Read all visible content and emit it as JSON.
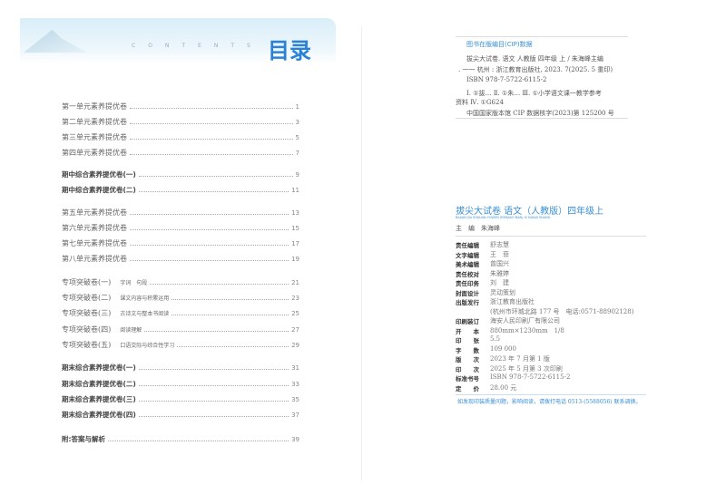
{
  "left_page": {
    "contents_label": "CONTENTS",
    "title": "目录",
    "toc": [
      {
        "title": "第一单元素养提优卷",
        "page": "1",
        "bold": false
      },
      {
        "title": "第二单元素养提优卷",
        "page": "3",
        "bold": false
      },
      {
        "title": "第三单元素养提优卷",
        "page": "5",
        "bold": false
      },
      {
        "title": "第四单元素养提优卷",
        "page": "7",
        "bold": false
      },
      {
        "title": "期中综合素养提优卷(一)",
        "page": "9",
        "bold": true
      },
      {
        "title": "期中综合素养提优卷(二)",
        "page": "11",
        "bold": true
      },
      {
        "title": "第五单元素养提优卷",
        "page": "13",
        "bold": false
      },
      {
        "title": "第六单元素养提优卷",
        "page": "15",
        "bold": false
      },
      {
        "title": "第七单元素养提优卷",
        "page": "17",
        "bold": false
      },
      {
        "title": "第八单元素养提优卷",
        "page": "19",
        "bold": false
      },
      {
        "title": "专项突破卷(一)",
        "sub": "字词　句段",
        "page": "21",
        "bold": false
      },
      {
        "title": "专项突破卷(二)",
        "sub": "课文内容与积累运用",
        "page": "23",
        "bold": false
      },
      {
        "title": "专项突破卷(三)",
        "sub": "古诗文与整本书阅读",
        "page": "25",
        "bold": false
      },
      {
        "title": "专项突破卷(四)",
        "sub": "阅读理解",
        "page": "27",
        "bold": false
      },
      {
        "title": "专项突破卷(五)",
        "sub": "口语交际与综合性学习",
        "page": "29",
        "bold": false
      },
      {
        "title": "期末综合素养提优卷(一)",
        "page": "31",
        "bold": true
      },
      {
        "title": "期末综合素养提优卷(二)",
        "page": "33",
        "bold": true
      },
      {
        "title": "期末综合素养提优卷(三)",
        "page": "35",
        "bold": true
      },
      {
        "title": "期末综合素养提优卷(四)",
        "page": "37",
        "bold": true
      },
      {
        "title": "附:答案与解析",
        "page": "39",
        "bold": true
      }
    ]
  },
  "right_page": {
    "cip_title": "图书在版编目(CIP)数据",
    "cip_lines": [
      "拔尖大试卷. 语文 人教版 四年级 上 / 朱海峰主编",
      ". 一一 杭州 : 浙江教育出版社, 2023. 7(2025. 5 重印)",
      "ISBN 978-7-5722-6115-2",
      "Ⅰ. ①拔… Ⅱ. ①朱… Ⅲ. ①小学语文课一教学参考",
      "资料 Ⅳ. ①G624",
      "中国国家版本馆 CIP 数据核字(2023)第 125200 号"
    ],
    "book_title": "拔尖大试卷 语文（人教版）四年级上",
    "book_pinyin": "BAJIAN DA SHIJUAN  YUWEN (RENJIAO BAN)  SI NIANJI SHANG",
    "editor": "主　编　朱海峰",
    "credits": [
      {
        "k": "责任编辑",
        "v": "舒志慧"
      },
      {
        "k": "文字编辑",
        "v": "王　菲"
      },
      {
        "k": "美术编辑",
        "v": "曾国兴"
      },
      {
        "k": "责任校对",
        "v": "朱雅婷"
      },
      {
        "k": "责任印务",
        "v": "刘　建"
      },
      {
        "k": "封面设计",
        "v": "灵动策划"
      },
      {
        "k": "出版发行",
        "v": "浙江教育出版社"
      },
      {
        "k": "",
        "v": "(杭州市环城北路 177 号　电话:0571-88902128)"
      },
      {
        "k": "印刷装订",
        "v": "海安人民印刷厂有限公司"
      },
      {
        "k": "开　　本",
        "v": "880mm×1230mm　1/8"
      },
      {
        "k": "印　　张",
        "v": "5.5"
      },
      {
        "k": "字　　数",
        "v": "109 000"
      },
      {
        "k": "版　　次",
        "v": "2023 年 7 月第 1 版"
      },
      {
        "k": "印　　次",
        "v": "2025 年 5 月第 3 次印刷"
      },
      {
        "k": "标准书号",
        "v": "ISBN 978-7-5722-6115-2"
      },
      {
        "k": "定　　价",
        "v": "28.00 元"
      }
    ],
    "notice": "如发现印装质量问题，影响阅读，请拨打电话 0513-(5588056) 联系调换。"
  }
}
